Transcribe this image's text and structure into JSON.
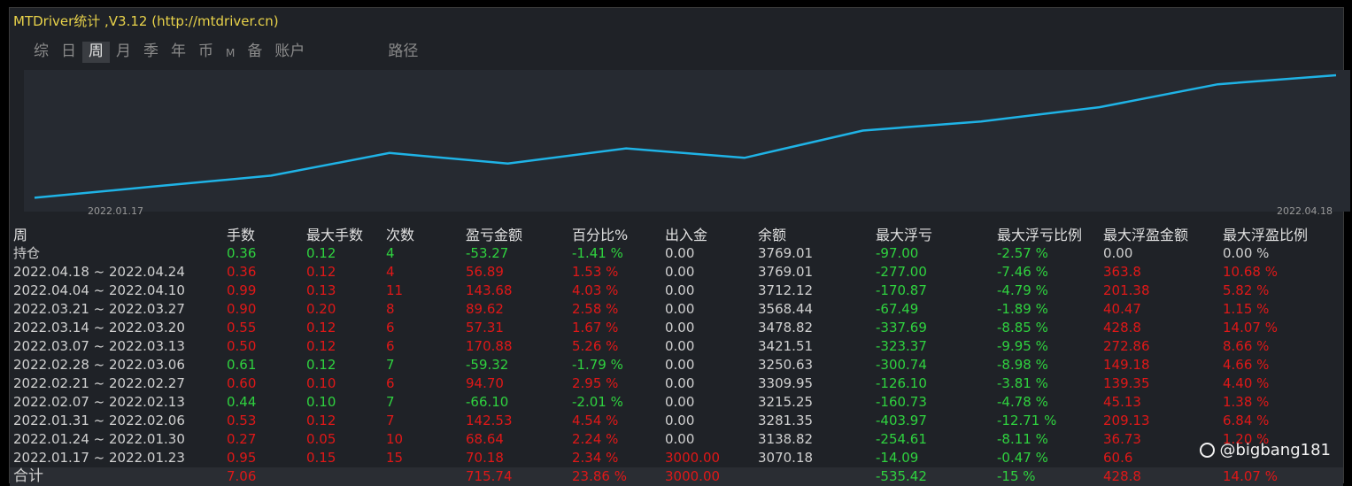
{
  "title": "MTDriver统计 ,V3.12 (http://mtdriver.cn)",
  "tabs": [
    "综",
    "日",
    "周",
    "月",
    "季",
    "年",
    "币",
    "M",
    "备",
    "账户",
    "路径"
  ],
  "active_tab": "周",
  "chart_data": {
    "type": "line",
    "x_start": "2022.01.17",
    "x_end": "2022.04.18",
    "values": [
      3000,
      3070.18,
      3138.82,
      3281.35,
      3215.25,
      3309.95,
      3250.63,
      3421.51,
      3478.82,
      3568.44,
      3712.12,
      3769.01
    ],
    "ylim": [
      2980,
      3780
    ],
    "color": "#1fb3e6",
    "grid": false
  },
  "columns": [
    "周",
    "手数",
    "最大手数",
    "次数",
    "盈亏金额",
    "百分比%",
    "出入金",
    "余额",
    "最大浮亏",
    "最大浮亏比例",
    "最大浮盈金额",
    "最大浮盈比例"
  ],
  "rows": [
    {
      "period": "持仓",
      "lots": "0.36",
      "max_lots": "0.12",
      "count": "4",
      "pnl": "-53.27",
      "pct": "-1.41 %",
      "flow": "0.00",
      "balance": "3769.01",
      "max_dd": "-97.00",
      "max_dd_pct": "-2.57 %",
      "max_fp": "0.00",
      "max_fp_pct": "0.00 %",
      "lots_c": "green",
      "max_lots_c": "green",
      "count_c": "green",
      "pnl_c": "green",
      "pct_c": "green",
      "flow_c": "white",
      "max_fp_c": "white",
      "max_fp_pct_c": "white"
    },
    {
      "period": "2022.04.18 ~ 2022.04.24",
      "lots": "0.36",
      "max_lots": "0.12",
      "count": "4",
      "pnl": "56.89",
      "pct": "1.53 %",
      "flow": "0.00",
      "balance": "3769.01",
      "max_dd": "-277.00",
      "max_dd_pct": "-7.46 %",
      "max_fp": "363.8",
      "max_fp_pct": "10.68 %",
      "lots_c": "red",
      "max_lots_c": "red",
      "count_c": "red",
      "pnl_c": "red",
      "pct_c": "red",
      "flow_c": "white",
      "max_fp_c": "red",
      "max_fp_pct_c": "red"
    },
    {
      "period": "2022.04.04 ~ 2022.04.10",
      "lots": "0.99",
      "max_lots": "0.13",
      "count": "11",
      "pnl": "143.68",
      "pct": "4.03 %",
      "flow": "0.00",
      "balance": "3712.12",
      "max_dd": "-170.87",
      "max_dd_pct": "-4.79 %",
      "max_fp": "201.38",
      "max_fp_pct": "5.82 %",
      "lots_c": "red",
      "max_lots_c": "red",
      "count_c": "red",
      "pnl_c": "red",
      "pct_c": "red",
      "flow_c": "white",
      "max_fp_c": "red",
      "max_fp_pct_c": "red"
    },
    {
      "period": "2022.03.21 ~ 2022.03.27",
      "lots": "0.90",
      "max_lots": "0.20",
      "count": "8",
      "pnl": "89.62",
      "pct": "2.58 %",
      "flow": "0.00",
      "balance": "3568.44",
      "max_dd": "-67.49",
      "max_dd_pct": "-1.89 %",
      "max_fp": "40.47",
      "max_fp_pct": "1.15 %",
      "lots_c": "red",
      "max_lots_c": "red",
      "count_c": "red",
      "pnl_c": "red",
      "pct_c": "red",
      "flow_c": "white",
      "max_fp_c": "red",
      "max_fp_pct_c": "red"
    },
    {
      "period": "2022.03.14 ~ 2022.03.20",
      "lots": "0.55",
      "max_lots": "0.12",
      "count": "6",
      "pnl": "57.31",
      "pct": "1.67 %",
      "flow": "0.00",
      "balance": "3478.82",
      "max_dd": "-337.69",
      "max_dd_pct": "-8.85 %",
      "max_fp": "428.8",
      "max_fp_pct": "14.07 %",
      "lots_c": "red",
      "max_lots_c": "red",
      "count_c": "red",
      "pnl_c": "red",
      "pct_c": "red",
      "flow_c": "white",
      "max_fp_c": "red",
      "max_fp_pct_c": "red"
    },
    {
      "period": "2022.03.07 ~ 2022.03.13",
      "lots": "0.50",
      "max_lots": "0.12",
      "count": "6",
      "pnl": "170.88",
      "pct": "5.26 %",
      "flow": "0.00",
      "balance": "3421.51",
      "max_dd": "-323.37",
      "max_dd_pct": "-9.95 %",
      "max_fp": "272.86",
      "max_fp_pct": "8.66 %",
      "lots_c": "red",
      "max_lots_c": "red",
      "count_c": "red",
      "pnl_c": "red",
      "pct_c": "red",
      "flow_c": "white",
      "max_fp_c": "red",
      "max_fp_pct_c": "red"
    },
    {
      "period": "2022.02.28 ~ 2022.03.06",
      "lots": "0.61",
      "max_lots": "0.12",
      "count": "7",
      "pnl": "-59.32",
      "pct": "-1.79 %",
      "flow": "0.00",
      "balance": "3250.63",
      "max_dd": "-300.74",
      "max_dd_pct": "-8.98 %",
      "max_fp": "149.18",
      "max_fp_pct": "4.66 %",
      "lots_c": "green",
      "max_lots_c": "green",
      "count_c": "green",
      "pnl_c": "green",
      "pct_c": "green",
      "flow_c": "white",
      "max_fp_c": "red",
      "max_fp_pct_c": "red"
    },
    {
      "period": "2022.02.21 ~ 2022.02.27",
      "lots": "0.60",
      "max_lots": "0.10",
      "count": "6",
      "pnl": "94.70",
      "pct": "2.95 %",
      "flow": "0.00",
      "balance": "3309.95",
      "max_dd": "-126.10",
      "max_dd_pct": "-3.81 %",
      "max_fp": "139.35",
      "max_fp_pct": "4.40 %",
      "lots_c": "red",
      "max_lots_c": "red",
      "count_c": "red",
      "pnl_c": "red",
      "pct_c": "red",
      "flow_c": "white",
      "max_fp_c": "red",
      "max_fp_pct_c": "red"
    },
    {
      "period": "2022.02.07 ~ 2022.02.13",
      "lots": "0.44",
      "max_lots": "0.10",
      "count": "7",
      "pnl": "-66.10",
      "pct": "-2.01 %",
      "flow": "0.00",
      "balance": "3215.25",
      "max_dd": "-160.73",
      "max_dd_pct": "-4.78 %",
      "max_fp": "45.13",
      "max_fp_pct": "1.38 %",
      "lots_c": "green",
      "max_lots_c": "green",
      "count_c": "green",
      "pnl_c": "green",
      "pct_c": "green",
      "flow_c": "white",
      "max_fp_c": "red",
      "max_fp_pct_c": "red"
    },
    {
      "period": "2022.01.31 ~ 2022.02.06",
      "lots": "0.53",
      "max_lots": "0.12",
      "count": "7",
      "pnl": "142.53",
      "pct": "4.54 %",
      "flow": "0.00",
      "balance": "3281.35",
      "max_dd": "-403.97",
      "max_dd_pct": "-12.71 %",
      "max_fp": "209.13",
      "max_fp_pct": "6.84 %",
      "lots_c": "red",
      "max_lots_c": "red",
      "count_c": "red",
      "pnl_c": "red",
      "pct_c": "red",
      "flow_c": "white",
      "max_fp_c": "red",
      "max_fp_pct_c": "red"
    },
    {
      "period": "2022.01.24 ~ 2022.01.30",
      "lots": "0.27",
      "max_lots": "0.05",
      "count": "10",
      "pnl": "68.64",
      "pct": "2.24 %",
      "flow": "0.00",
      "balance": "3138.82",
      "max_dd": "-254.61",
      "max_dd_pct": "-8.11 %",
      "max_fp": "36.73",
      "max_fp_pct": "1.20 %",
      "lots_c": "red",
      "max_lots_c": "red",
      "count_c": "red",
      "pnl_c": "red",
      "pct_c": "red",
      "flow_c": "white",
      "max_fp_c": "red",
      "max_fp_pct_c": "red"
    },
    {
      "period": "2022.01.17 ~ 2022.01.23",
      "lots": "0.95",
      "max_lots": "0.15",
      "count": "15",
      "pnl": "70.18",
      "pct": "2.34 %",
      "flow": "3000.00",
      "balance": "3070.18",
      "max_dd": "-14.09",
      "max_dd_pct": "-0.47 %",
      "max_fp": "60.6",
      "max_fp_pct": "",
      "lots_c": "red",
      "max_lots_c": "red",
      "count_c": "red",
      "pnl_c": "red",
      "pct_c": "red",
      "flow_c": "red",
      "max_fp_c": "red",
      "max_fp_pct_c": "red"
    }
  ],
  "total": {
    "period": "合计",
    "lots": "7.06",
    "max_lots": "",
    "count": "",
    "pnl": "715.74",
    "pct": "23.86 %",
    "flow": "3000.00",
    "balance": "",
    "max_dd": "-535.42",
    "max_dd_pct": "-15 %",
    "max_fp": "428.8",
    "max_fp_pct": "14.07 %"
  },
  "watermark": "@bigbang181"
}
